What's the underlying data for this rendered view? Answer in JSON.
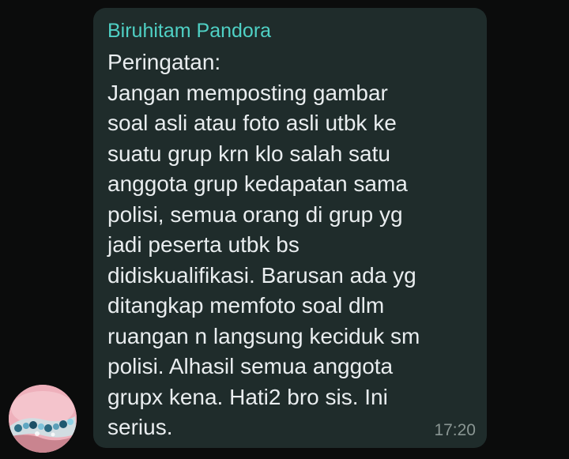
{
  "chat": {
    "message": {
      "sender": "Biruhitam Pandora",
      "lines": [
        "Peringatan:",
        "Jangan memposting gambar",
        "soal asli atau foto asli utbk ke",
        "suatu grup krn klo salah satu",
        "anggota grup kedapatan sama",
        "polisi, semua orang di grup yg",
        "jadi peserta utbk bs",
        "didiskualifikasi. Barusan ada yg",
        "ditangkap memfoto soal dlm",
        "ruangan n langsung keciduk sm",
        "polisi. Alhasil semua anggota",
        "grupx kena. Hati2 bro sis. Ini",
        "serius."
      ],
      "time": "17:20"
    }
  },
  "colors": {
    "background": "#0b0c0c",
    "bubble": "#1f2c2b",
    "sender_name": "#4fd1c5",
    "message_text": "#e9edef",
    "timestamp": "#8a9693",
    "avatar_background": "#e8a7b2"
  },
  "avatar": {
    "icon": "profile-photo-bracelet"
  }
}
